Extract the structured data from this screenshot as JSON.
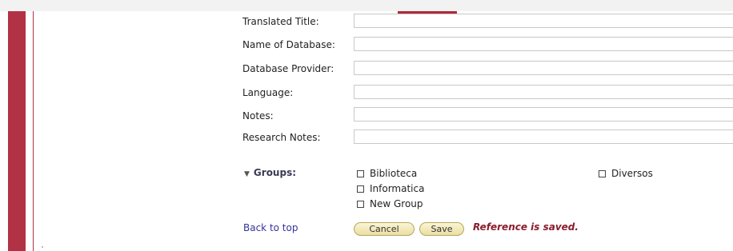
{
  "fields": [
    {
      "label": "Translated Title:",
      "value": ""
    },
    {
      "label": "Name of Database:",
      "value": ""
    },
    {
      "label": "Database Provider:",
      "value": ""
    },
    {
      "label": "Language:",
      "value": ""
    },
    {
      "label": "Notes:",
      "value": ""
    },
    {
      "label": "Research Notes:",
      "value": ""
    }
  ],
  "groups": {
    "heading": "Groups:",
    "items": [
      "Biblioteca",
      "Informatica",
      "New Group",
      "Diversos"
    ]
  },
  "footer": {
    "back_to_top": "Back to top",
    "cancel_label": "Cancel",
    "save_label": "Save",
    "status_message": "Reference is saved."
  },
  "colors": {
    "accent_red": "#b23245",
    "link_blue": "#33339a",
    "status_red": "#8a1c2c"
  }
}
